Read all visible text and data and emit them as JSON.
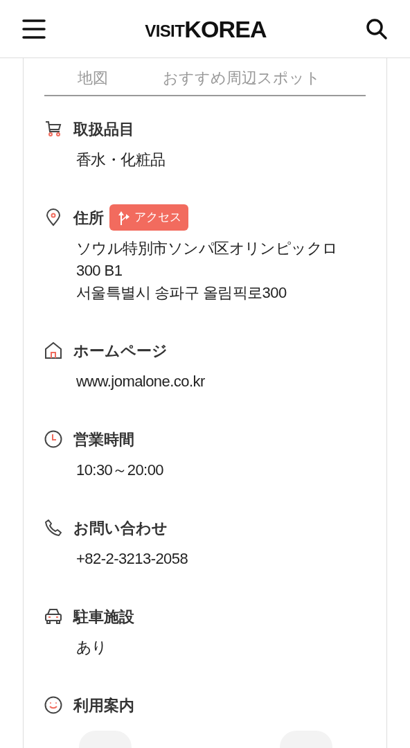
{
  "header": {
    "logo": {
      "small": "VISIT",
      "large": "KOREA"
    }
  },
  "tabs": [
    {
      "label": "地図",
      "selected": false
    },
    {
      "label": "おすすめ周辺スポット",
      "selected": false
    }
  ],
  "sections": [
    {
      "kind": "cart",
      "title": "取扱品目",
      "lines": [
        "香水・化粧品"
      ]
    },
    {
      "kind": "pin",
      "title": "住所",
      "badge": "アクセス",
      "lines": [
        "ソウル特別市ソンパ区オリンピックロ",
        "300 B1",
        "서울특별시 송파구 올림픽로300"
      ]
    },
    {
      "kind": "home",
      "title": "ホームページ",
      "lines": [
        "www.jomalone.co.kr"
      ]
    },
    {
      "kind": "clock",
      "title": "営業時間",
      "lines": [
        "10:30～20:00"
      ]
    },
    {
      "kind": "phone",
      "title": "お問い合わせ",
      "lines": [
        "+82-2-3213-2058"
      ]
    },
    {
      "kind": "car",
      "title": "駐車施設",
      "lines": [
        "あり"
      ]
    },
    {
      "kind": "smile",
      "title": "利用案内"
    }
  ]
}
